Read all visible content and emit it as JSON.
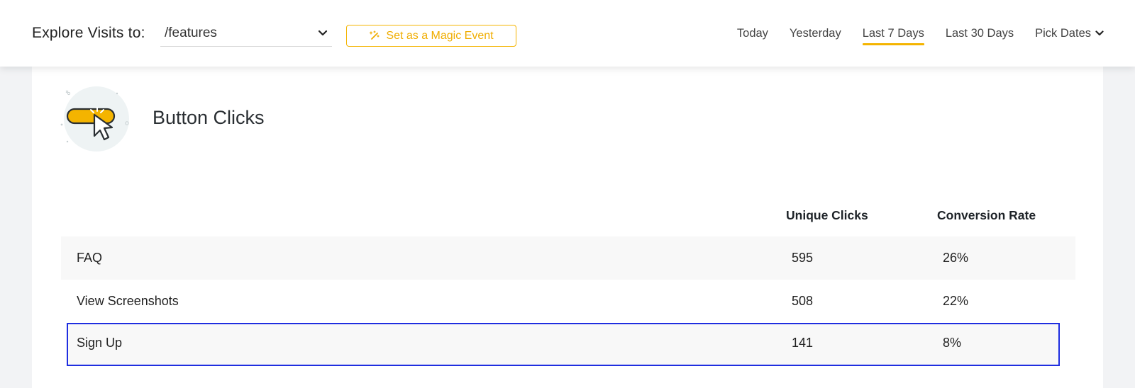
{
  "header": {
    "explore_label": "Explore Visits to:",
    "page_select_value": "/features",
    "magic_event_label": "Set as a Magic Event",
    "date_tabs": [
      {
        "label": "Today",
        "active": false
      },
      {
        "label": "Yesterday",
        "active": false
      },
      {
        "label": "Last 7 Days",
        "active": true
      },
      {
        "label": "Last 30 Days",
        "active": false
      },
      {
        "label": "Pick Dates",
        "active": false
      }
    ]
  },
  "card": {
    "title": "Button Clicks",
    "columns": {
      "unique_clicks": "Unique Clicks",
      "conversion_rate": "Conversion Rate"
    },
    "rows": [
      {
        "name": "FAQ",
        "unique_clicks": "595",
        "conversion_rate": "26%"
      },
      {
        "name": "View Screenshots",
        "unique_clicks": "508",
        "conversion_rate": "22%"
      },
      {
        "name": "Sign Up",
        "unique_clicks": "141",
        "conversion_rate": "8%"
      }
    ]
  },
  "icons": {
    "select_chevron": "chevron-down-icon",
    "magic": "magic-wand-icon",
    "pick_dates_chevron": "chevron-down-icon",
    "illustration": "button-click-icon"
  },
  "colors": {
    "accent": "#f4b400",
    "highlight_outline": "#1f2ee0",
    "row_alt": "#f8f8f8"
  }
}
